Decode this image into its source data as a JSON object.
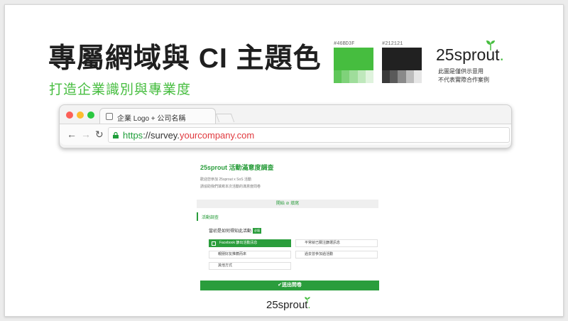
{
  "slide": {
    "title": "專屬網域與 CI 主題色",
    "subtitle": "打造企業識別與專業度"
  },
  "swatches": [
    {
      "hex": "#46BD3F",
      "tints": [
        "#5fc759",
        "#7fd27a",
        "#9fdd9b",
        "#bfe8bc",
        "#dff3dd"
      ]
    },
    {
      "hex": "#212121",
      "tints": [
        "#3a3a3a",
        "#5a5a5a",
        "#8a8a8a",
        "#bdbdbd",
        "#e6e6e6"
      ]
    }
  ],
  "logo": {
    "text": "25sprout",
    "dot": "."
  },
  "disclaimer": [
    "此圖是僅供示意用",
    "不代表實際合作案例"
  ],
  "browser": {
    "tab_title": "企業 Logo + 公司名稱",
    "url_scheme": "https",
    "url_rest": "://survey.",
    "url_domain": "yourcompany.com",
    "back": "←",
    "forward": "→",
    "reload": "↻"
  },
  "form": {
    "title": "25sprout 活動滿意度調查",
    "desc1": "歡迎您參加 25sprout x SoS 活動",
    "desc2": "請協助我們填寫本次活動的滿意度問卷",
    "start": "開始 ⊘ 填寫",
    "section": "活動調查",
    "question": "當初是如何得知此活動",
    "required": "必填",
    "options": [
      "Facebook 篩出活動訊息",
      "平常就已關注篩選訊息",
      "親朋好友推薦而來",
      "過去曾參加過活動",
      "其他方式"
    ],
    "submit": "✔送出問卷"
  },
  "colors": {
    "green": "#46BD3F",
    "dark": "#212121",
    "form_green": "#2a9d3c",
    "url_red": "#e0393e"
  }
}
